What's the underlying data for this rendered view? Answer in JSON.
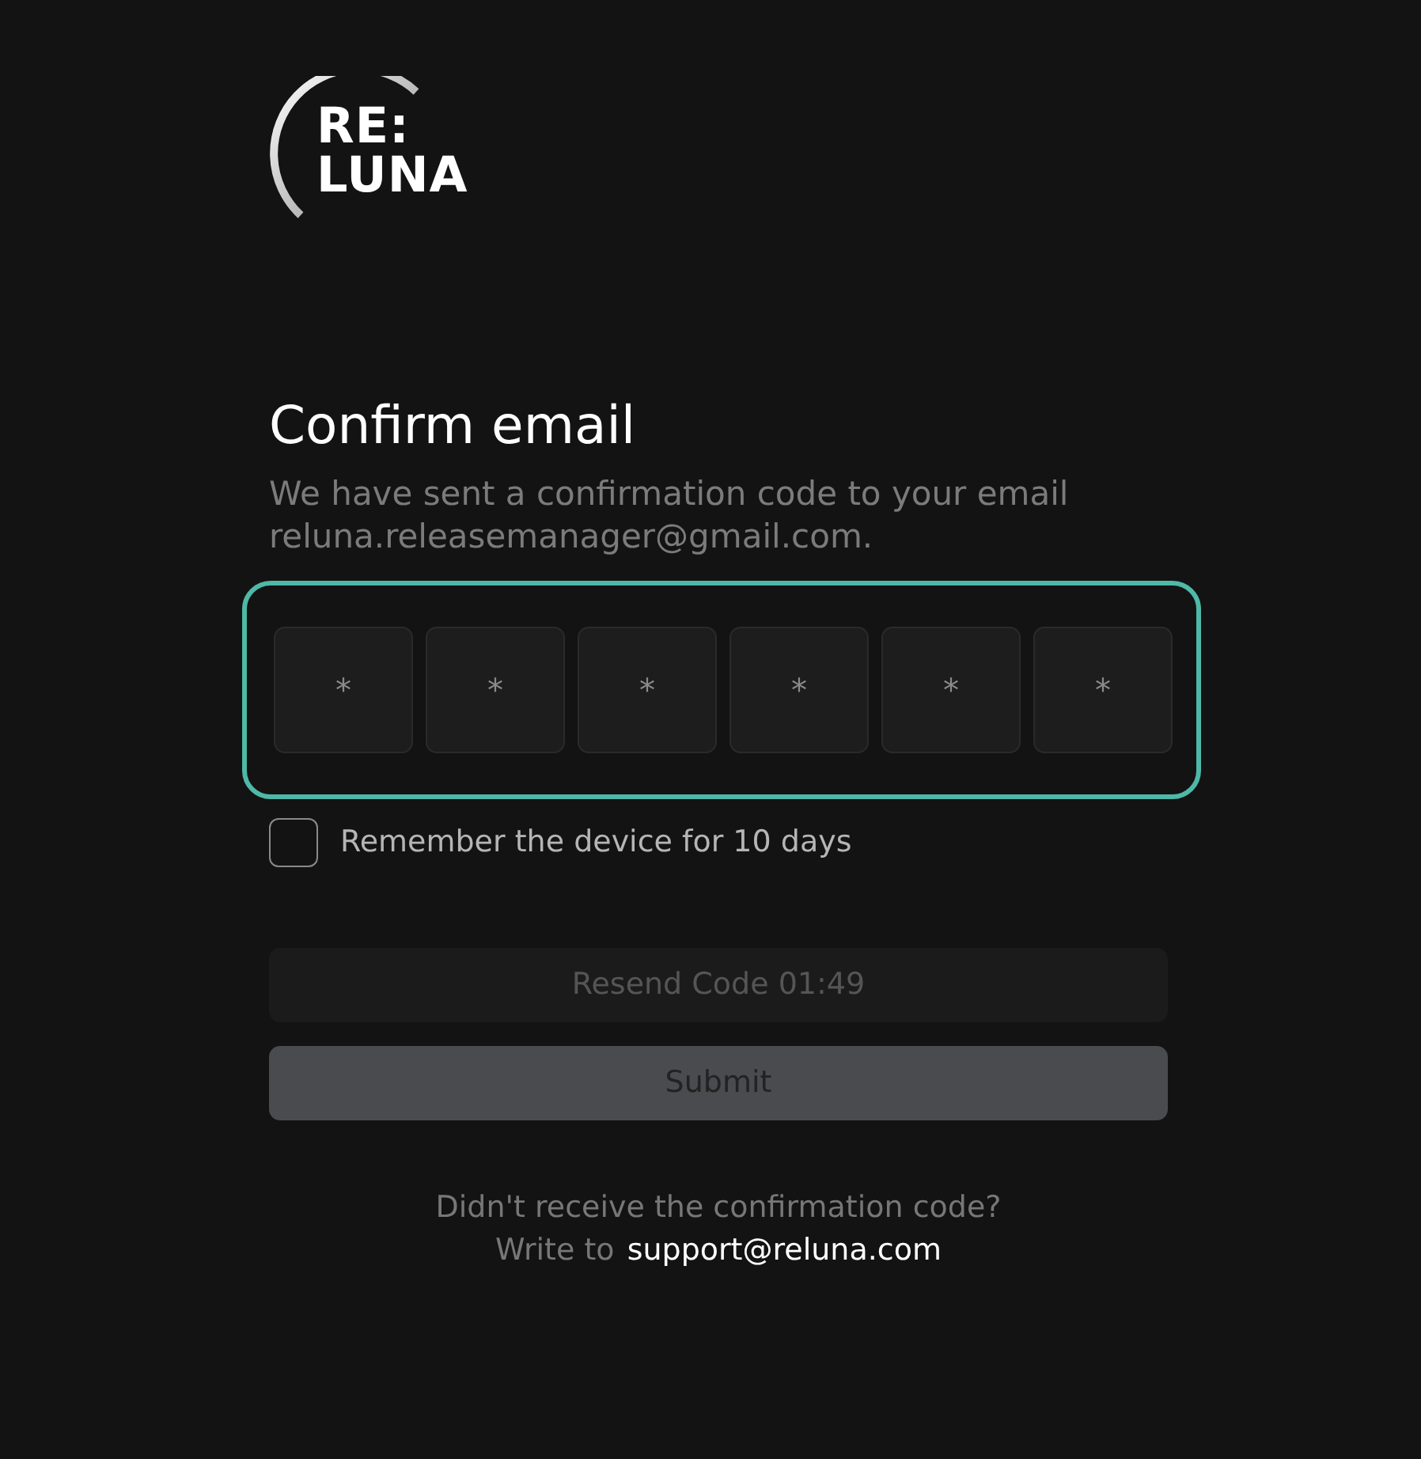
{
  "logo": {
    "line_1": "RE:",
    "line_2": "LUNA"
  },
  "title": "Confirm email",
  "description": "We have sent a confirmation code to your email reluna.releasemanager@gmail.com.",
  "code": {
    "focused": true,
    "digits": [
      {
        "placeholder": "*"
      },
      {
        "placeholder": "*"
      },
      {
        "placeholder": "*"
      },
      {
        "placeholder": "*"
      },
      {
        "placeholder": "*"
      },
      {
        "placeholder": "*"
      }
    ]
  },
  "remember": {
    "label": "Remember the device for 10 days",
    "checked": false
  },
  "resend_button": {
    "label": "Resend Code 01:49",
    "disabled": true
  },
  "submit_button": {
    "label": "Submit",
    "disabled": true
  },
  "help": {
    "text": "Didn't receive the confirmation code?",
    "prefix": "Write to",
    "link": "support@reluna.com"
  }
}
